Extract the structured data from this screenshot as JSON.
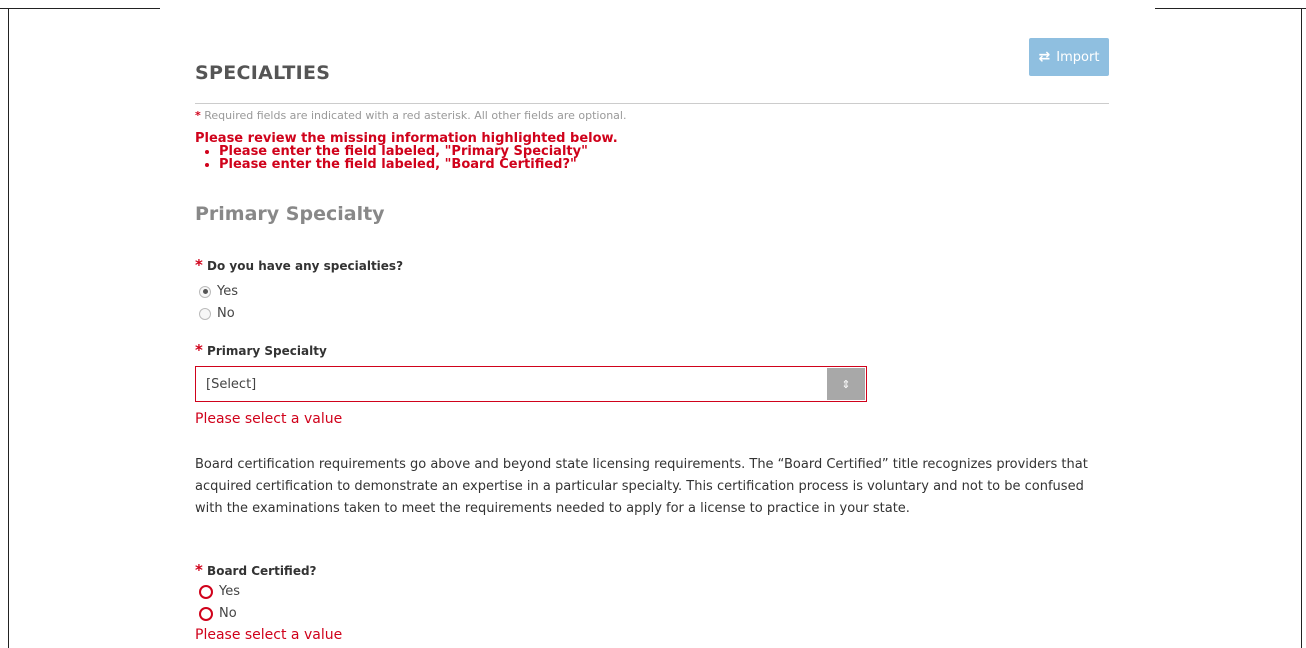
{
  "section": {
    "title": "SPECIALTIES",
    "import_label": "Import",
    "required_note": " Required fields are indicated with a red asterisk. All other fields are optional.",
    "required_star": "*"
  },
  "errors": {
    "summary": "Please review the missing information highlighted below.",
    "items": [
      "Please enter the field labeled, \"Primary Specialty\"",
      "Please enter the field labeled, \"Board Certified?\""
    ]
  },
  "primary": {
    "title": "Primary Specialty",
    "has_specialties_question": "Do you have any specialties?",
    "has_specialties_options": [
      "Yes",
      "No"
    ],
    "has_specialties_selected": "Yes",
    "specialty_label": "Primary Specialty",
    "specialty_value": "[Select]",
    "specialty_error": "Please select a value",
    "board_info": "Board certification requirements go above and beyond state licensing requirements. The “Board Certified” title recognizes providers that acquired certification to demonstrate an expertise in a particular specialty. This certification process is voluntary and not to be confused with the examinations taken to meet the requirements needed to apply for a license to practice in your state.",
    "board_question": "Board Certified?",
    "board_options": [
      "Yes",
      "No"
    ],
    "board_error": "Please select a value"
  },
  "colors": {
    "error": "#d0021b",
    "import_button": "#8fbfe0"
  },
  "icons": {
    "import": "swap-arrows-icon",
    "select": "chevron-up-down-icon"
  }
}
